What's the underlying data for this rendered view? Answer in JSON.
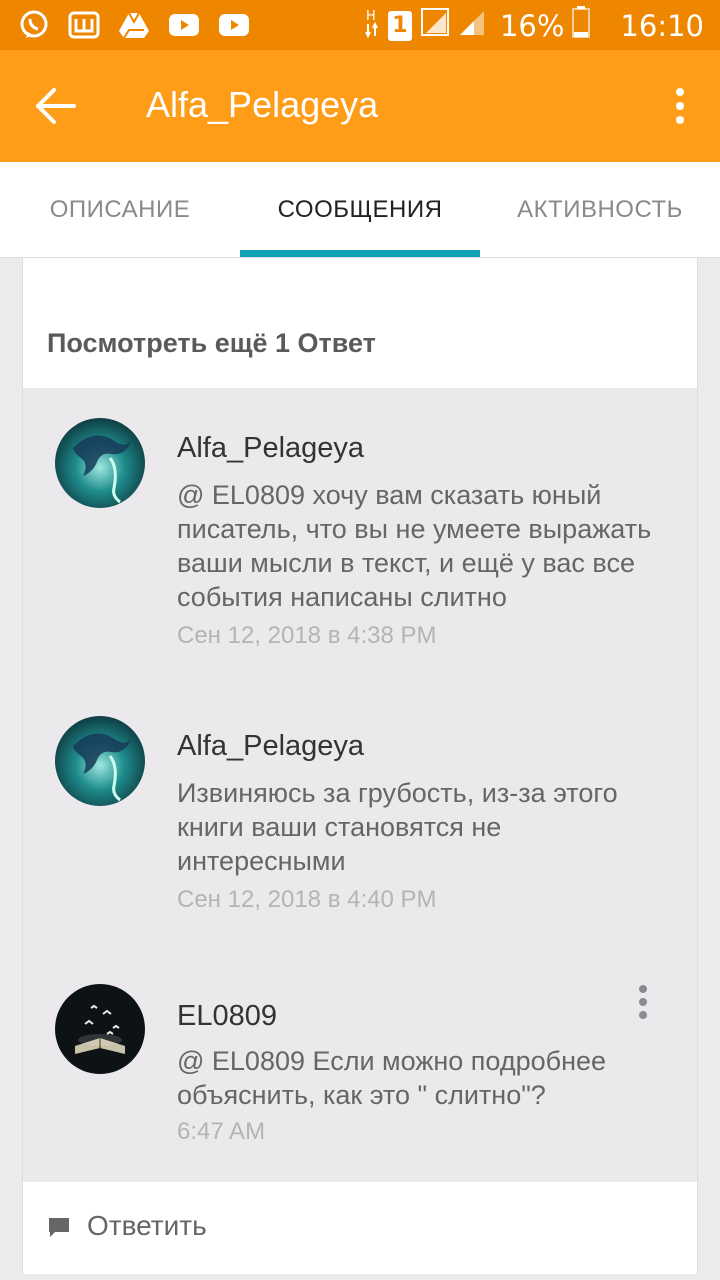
{
  "status_bar": {
    "icons_left": [
      "viber-icon",
      "w-app-icon",
      "drive-icon",
      "youtube-icon",
      "youtube-icon"
    ],
    "sim_badge": "1",
    "battery": "16%",
    "time": "16:10"
  },
  "app_bar": {
    "title": "Alfa_Pelageya"
  },
  "tabs": [
    {
      "label": "ОПИСАНИЕ"
    },
    {
      "label": "СООБЩЕНИЯ"
    },
    {
      "label": "АКТИВНОСТЬ"
    }
  ],
  "thread": {
    "more_replies_label": "Посмотреть ещё 1 Ответ",
    "comments": [
      {
        "author": "Alfa_Pelageya",
        "text": "@ EL0809  хочу вам сказать юный писатель, что вы не умеете выражать ваши мысли в текст, и ещё у вас все события написаны слитно",
        "time": "Сен 12, 2018 в 4:38 PM"
      },
      {
        "author": "Alfa_Pelageya",
        "text": "Извиняюсь за грубость, из-за этого книги ваши становятся не интересными",
        "time": "Сен 12, 2018 в 4:40 PM"
      },
      {
        "author": "EL0809",
        "text": "@ EL0809  Если можно подробнее объяснить,  как это \" слитно\"?",
        "time": "6:47 AM"
      }
    ],
    "reply_label": "Ответить"
  },
  "colors": {
    "status_bar": "#ee8600",
    "app_bar": "#ff9d18",
    "tab_indicator": "#11a3b5"
  }
}
